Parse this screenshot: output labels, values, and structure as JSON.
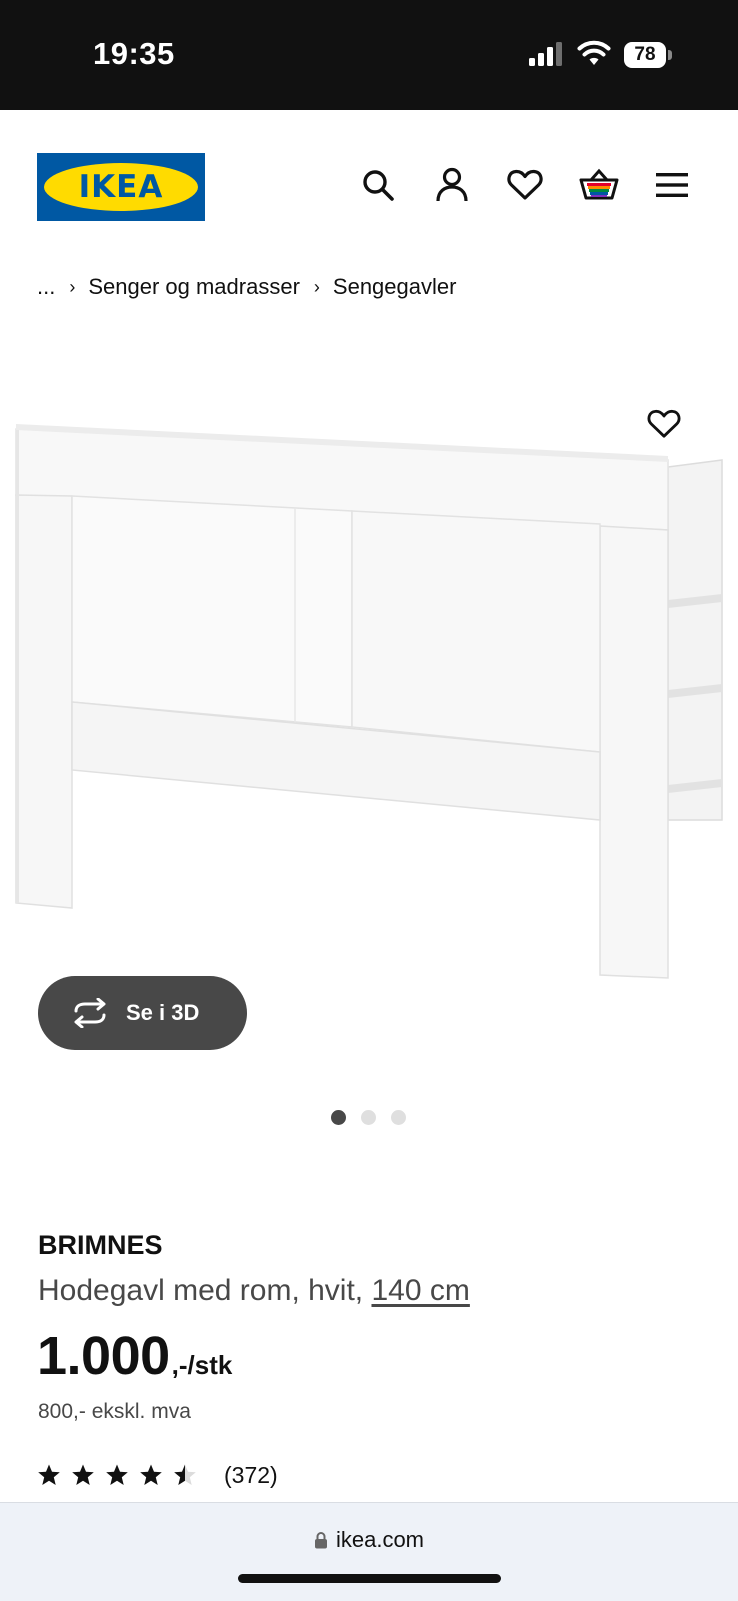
{
  "status_bar": {
    "time": "19:35",
    "battery": "78"
  },
  "header": {
    "logo_text": "IKEA",
    "icons": [
      "search-icon",
      "account-icon",
      "heart-icon",
      "basket-icon",
      "menu-icon"
    ]
  },
  "breadcrumb": {
    "ellipsis": "...",
    "items": [
      "Senger og madrasser",
      "Sengegavler"
    ]
  },
  "product": {
    "brand": "BRIMNES",
    "description": "Hodegavl med rom, hvit,",
    "size": "140 cm",
    "price": "1.000",
    "price_unit": ",-/stk",
    "price_excl_vat": "800,- ekskl. mva",
    "rating_value": 4.5,
    "rating_count": "(372)",
    "view_3d_label": "Se i 3D",
    "carousel": {
      "total": 3,
      "active": 1
    }
  },
  "browser": {
    "url": "ikea.com"
  },
  "colors": {
    "ikea_blue": "#0058a3",
    "ikea_yellow": "#ffdb00",
    "button_dark": "#484848"
  }
}
